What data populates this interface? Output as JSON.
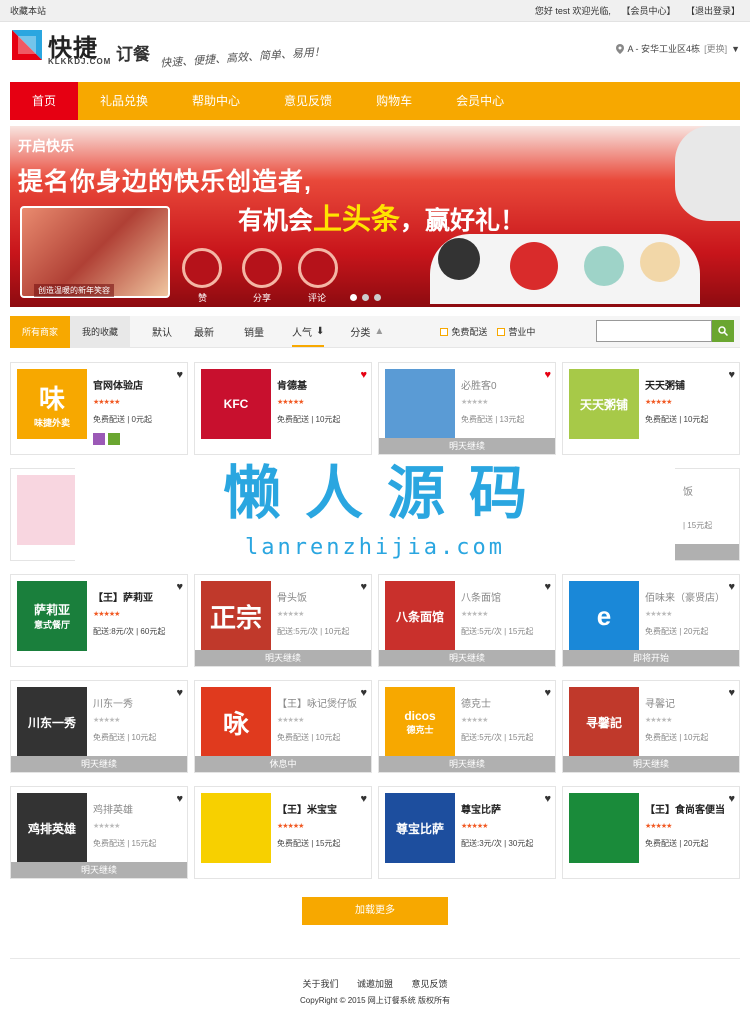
{
  "topbar": {
    "bookmark": "收藏本站",
    "greeting": "您好 test 欢迎光临,",
    "member_center": "【会员中心】",
    "logout": "【退出登录】"
  },
  "header": {
    "logo_text": "快捷",
    "logo_sub": "KLKKDJ.COM",
    "logo_order": "订餐",
    "slogan": "快速、便捷、高效、简单、易用！",
    "location": "A - 安华工业区4栋",
    "change": "[更换]"
  },
  "nav": {
    "items": [
      "首页",
      "礼品兑换",
      "帮助中心",
      "意见反馈",
      "购物车",
      "会员中心"
    ]
  },
  "banner": {
    "line1": "开启快乐",
    "line2": "提名你身边的快乐创造者,",
    "line3a": "有机会",
    "line3b": "上头条",
    "line3c": "，赢好礼！",
    "caption": "创造温暖的新年笑容",
    "btn1": "赞",
    "btn2": "分享",
    "btn3": "评论"
  },
  "filter": {
    "all": "所有商家",
    "fav": "我的收藏",
    "sort_default": "默认",
    "sort_new": "最新",
    "sort_sales": "销量",
    "sort_pop": "人气",
    "category": "分类",
    "free_delivery": "免费配送",
    "open": "营业中",
    "search_placeholder": ""
  },
  "shops": [
    {
      "name": "官网体验店",
      "info": "免费配送 | 0元起",
      "status": "",
      "img_text": "味",
      "img_sub": "味捷外卖",
      "color": "#f7a800"
    },
    {
      "name": "肯德基",
      "info": "免费配送 | 10元起",
      "status": "",
      "img_text": "KFC",
      "img_sub": "",
      "color": "#c8102e"
    },
    {
      "name": "必胜客0",
      "info": "免费配送 | 13元起",
      "status": "明天继续",
      "img_text": "",
      "img_sub": "",
      "color": "#5a9bd5"
    },
    {
      "name": "天天粥铺",
      "info": "免费配送 | 10元起",
      "status": "",
      "img_text": "天天粥铺",
      "img_sub": "",
      "color": "#a7c948"
    },
    {
      "name": "萨莉亚",
      "prefix": "【王】",
      "info": "配送:8元/次 | 60元起",
      "status": "",
      "img_text": "萨莉亚",
      "img_sub": "意式餐厅",
      "color": "#1a7f3c"
    },
    {
      "name": "骨头饭",
      "info": "配送:5元/次 | 10元起",
      "status": "明天继续",
      "img_text": "正宗",
      "img_sub": "",
      "color": "#c0392b"
    },
    {
      "name": "八条面馆",
      "info": "配送:5元/次 | 15元起",
      "status": "明天继续",
      "img_text": "八条面馆",
      "img_sub": "",
      "color": "#c9302c"
    },
    {
      "name": "佰味来（豪贤店）",
      "info": "免费配送 | 20元起",
      "status": "即将开始",
      "img_text": "e",
      "img_sub": "",
      "color": "#1a88d8"
    },
    {
      "name": "川东一秀",
      "info": "免费配送 | 10元起",
      "status": "明天继续",
      "img_text": "川东一秀",
      "img_sub": "",
      "color": "#333"
    },
    {
      "name": "咏记煲仔饭",
      "prefix": "【王】",
      "info": "免费配送 | 10元起",
      "status": "休息中",
      "img_text": "咏",
      "img_sub": "",
      "color": "#e03a1e"
    },
    {
      "name": "德克士",
      "info": "配送:5元/次 | 15元起",
      "status": "明天继续",
      "img_text": "dicos",
      "img_sub": "德克士",
      "color": "#f7a800"
    },
    {
      "name": "寻馨记",
      "info": "免费配送 | 10元起",
      "status": "明天继续",
      "img_text": "寻馨記",
      "img_sub": "",
      "color": "#c0392b"
    },
    {
      "name": "鸡排英雄",
      "info": "免费配送 | 15元起",
      "status": "明天继续",
      "img_text": "鸡排英雄",
      "img_sub": "",
      "color": "#333"
    },
    {
      "name": "米宝宝",
      "prefix": "【王】",
      "info": "免费配送 | 15元起",
      "status": "",
      "img_text": "",
      "img_sub": "",
      "color": "#f7d000"
    },
    {
      "name": "尊宝比萨",
      "info": "配送:3元/次 | 30元起",
      "status": "",
      "img_text": "尊宝比萨",
      "img_sub": "",
      "color": "#1d4e9e"
    },
    {
      "name": "食尚客便当",
      "prefix": "【王】",
      "info": "免费配送 | 20元起",
      "status": "",
      "img_text": "",
      "img_sub": "",
      "color": "#1a8b3a"
    }
  ],
  "partial_row": {
    "left_text": "骨头饭",
    "right_text1": "饭",
    "right_text2": "| 15元起"
  },
  "watermark": {
    "title": "懒人源码",
    "url": "lanrenzhijia.com"
  },
  "more_button": "加载更多",
  "footer": {
    "links": [
      "关于我们",
      "诚邀加盟",
      "意见反馈"
    ],
    "copyright": "CopyRight © 2015 网上订餐系统 版权所有"
  }
}
